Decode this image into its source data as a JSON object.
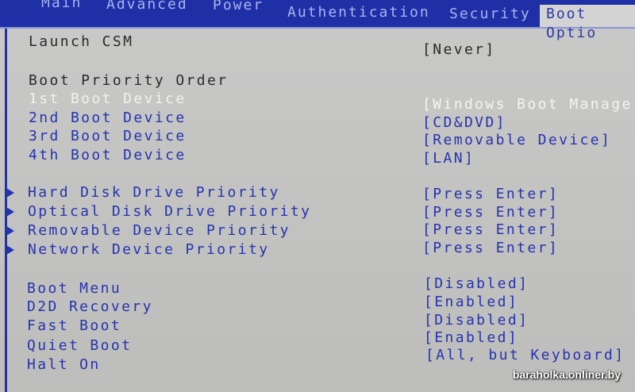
{
  "tabs": [
    {
      "label": "Main"
    },
    {
      "label": "Advanced"
    },
    {
      "label": "Power"
    },
    {
      "label": "Authentication"
    },
    {
      "label": "Security"
    },
    {
      "label": "Boot Optio"
    }
  ],
  "settings": {
    "launch_csm": {
      "label": "Launch CSM",
      "value": "[Never]"
    },
    "boot_priority_header": "Boot Priority Order",
    "boot_devices": [
      {
        "label": "1st Boot Device",
        "value": "[Windows Boot Manager]"
      },
      {
        "label": "2nd Boot Device",
        "value": "[CD&DVD]"
      },
      {
        "label": "3rd Boot Device",
        "value": "[Removable Device]"
      },
      {
        "label": "4th Boot Device",
        "value": "[LAN]"
      }
    ],
    "submenus": [
      {
        "label": "Hard Disk Drive Priority",
        "value": "[Press Enter]"
      },
      {
        "label": "Optical Disk Drive Priority",
        "value": "[Press Enter]"
      },
      {
        "label": "Removable Device Priority",
        "value": "[Press Enter]"
      },
      {
        "label": "Network Device Priority",
        "value": "[Press Enter]"
      }
    ],
    "options": [
      {
        "label": "Boot Menu",
        "value": "[Disabled]"
      },
      {
        "label": "D2D Recovery",
        "value": "[Enabled]"
      },
      {
        "label": "Fast Boot",
        "value": "[Disabled]"
      },
      {
        "label": "Quiet Boot",
        "value": "[Enabled]"
      },
      {
        "label": "Halt On",
        "value": "[All, but Keyboard]"
      }
    ]
  },
  "watermark": "baraholka.onliner.by",
  "colors": {
    "tab_bar": "#1f2fa6",
    "text_blue": "#2434b0",
    "background": "#c6c6c4"
  }
}
